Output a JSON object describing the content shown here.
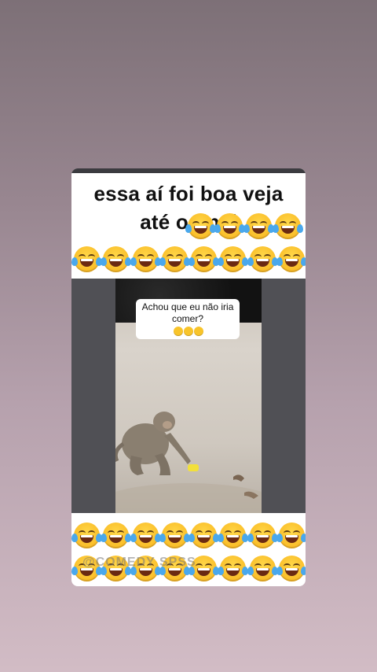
{
  "post": {
    "headline_line1": "essa aí foi boa veja",
    "headline_line2": "até o final",
    "video_caption_line1": "Achou que eu não iria",
    "video_caption_line2": "comer?",
    "watermark": "@COMEDY SPSS"
  },
  "icons": {
    "emoji": "face-with-tears-of-joy-icon"
  },
  "colors": {
    "card_background": "#ffffff",
    "video_side_bands": "#505055"
  }
}
